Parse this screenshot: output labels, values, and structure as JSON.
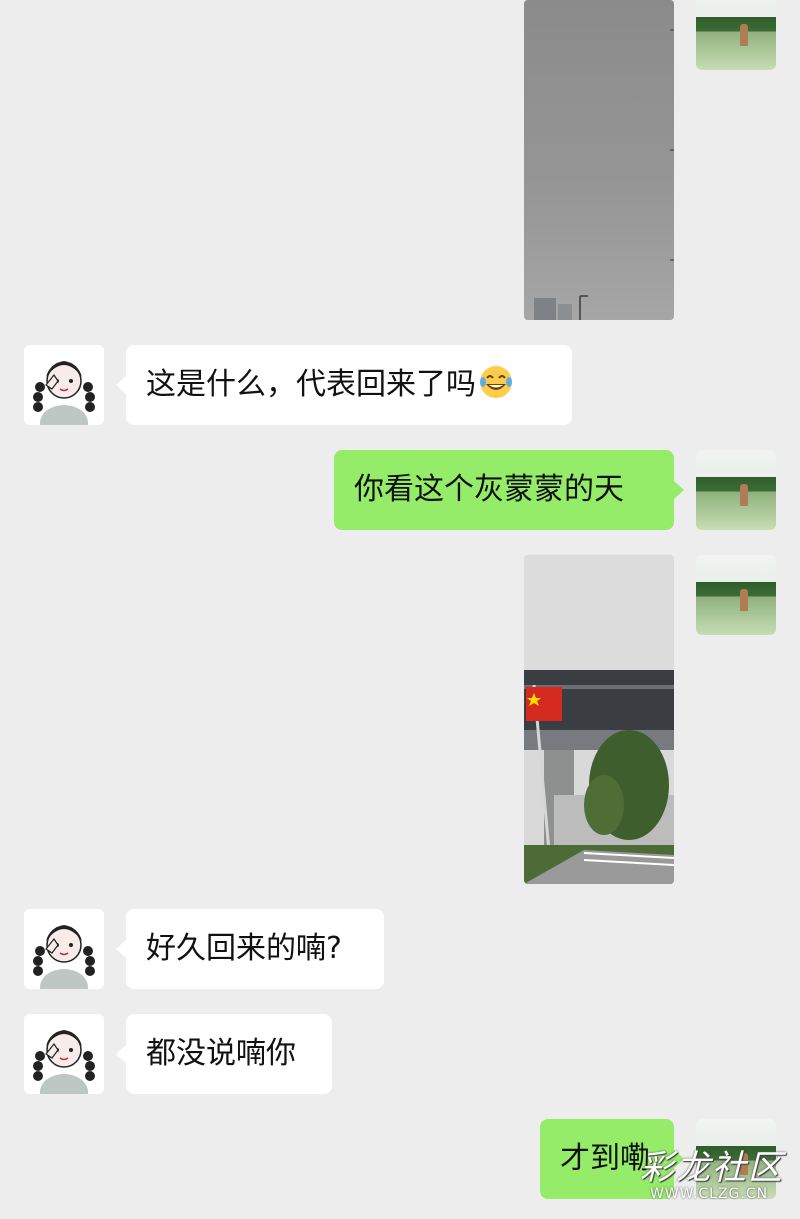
{
  "messages": [
    {
      "id": 1,
      "side": "right",
      "type": "image",
      "image_desc": "grey overcast sky photo"
    },
    {
      "id": 2,
      "side": "left",
      "type": "text",
      "text": "这是什么，代表回来了吗",
      "emoji": "face-with-tears-of-joy"
    },
    {
      "id": 3,
      "side": "right",
      "type": "text",
      "text": "你看这个灰蒙蒙的天"
    },
    {
      "id": 4,
      "side": "right",
      "type": "image",
      "image_desc": "street with flag under overcast sky"
    },
    {
      "id": 5,
      "side": "left",
      "type": "text",
      "text": "好久回来的喃?"
    },
    {
      "id": 6,
      "side": "left",
      "type": "text",
      "text": "都没说喃你"
    },
    {
      "id": 7,
      "side": "right",
      "type": "text",
      "text": "才到嘞"
    }
  ],
  "watermark": {
    "title": "彩龙社区",
    "url": "WWW.CLZG.CN"
  },
  "colors": {
    "background": "#ededed",
    "bubble_received": "#ffffff",
    "bubble_sent": "#95ec69",
    "text": "#111111"
  }
}
